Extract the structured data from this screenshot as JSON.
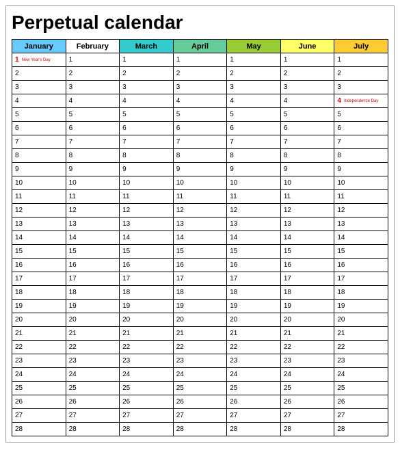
{
  "title": "Perpetual calendar",
  "months": [
    {
      "name": "January",
      "bg": "#66CCFF"
    },
    {
      "name": "February",
      "bg": "#FFFFFF"
    },
    {
      "name": "March",
      "bg": "#33CCCC"
    },
    {
      "name": "April",
      "bg": "#66CC99"
    },
    {
      "name": "May",
      "bg": "#99CC33"
    },
    {
      "name": "June",
      "bg": "#FFFF66"
    },
    {
      "name": "July",
      "bg": "#FFCC33"
    }
  ],
  "day_range": {
    "start": 1,
    "end": 28
  },
  "holidays": [
    {
      "month": 0,
      "day": 1,
      "label": "New Year's Day"
    },
    {
      "month": 6,
      "day": 4,
      "label": "Independence Day"
    }
  ]
}
